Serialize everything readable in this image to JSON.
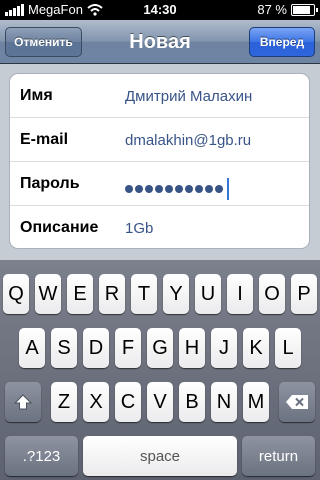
{
  "status": {
    "carrier": "MegaFon",
    "time": "14:30",
    "battery_text": "87 %",
    "battery_level": 0.87
  },
  "nav": {
    "title": "Новая",
    "cancel_label": "Отменить",
    "forward_label": "Вперед"
  },
  "form": {
    "name_label": "Имя",
    "name_value": "Дмитрий Малахин",
    "email_label": "E-mail",
    "email_value": "dmalakhin@1gb.ru",
    "password_label": "Пароль",
    "password_length": 10,
    "description_label": "Описание",
    "description_value": "1Gb"
  },
  "keyboard": {
    "row1": [
      "Q",
      "W",
      "E",
      "R",
      "T",
      "Y",
      "U",
      "I",
      "O",
      "P"
    ],
    "row2": [
      "A",
      "S",
      "D",
      "F",
      "G",
      "H",
      "J",
      "K",
      "L"
    ],
    "row3": [
      "Z",
      "X",
      "C",
      "V",
      "B",
      "N",
      "M"
    ],
    "numbers_label": ".?123",
    "space_label": "space",
    "return_label": "return",
    "shift_icon": "shift-arrow-icon",
    "delete_icon": "backspace-icon"
  },
  "colors": {
    "value_text": "#385487",
    "forward_button": "#3c74e6"
  }
}
